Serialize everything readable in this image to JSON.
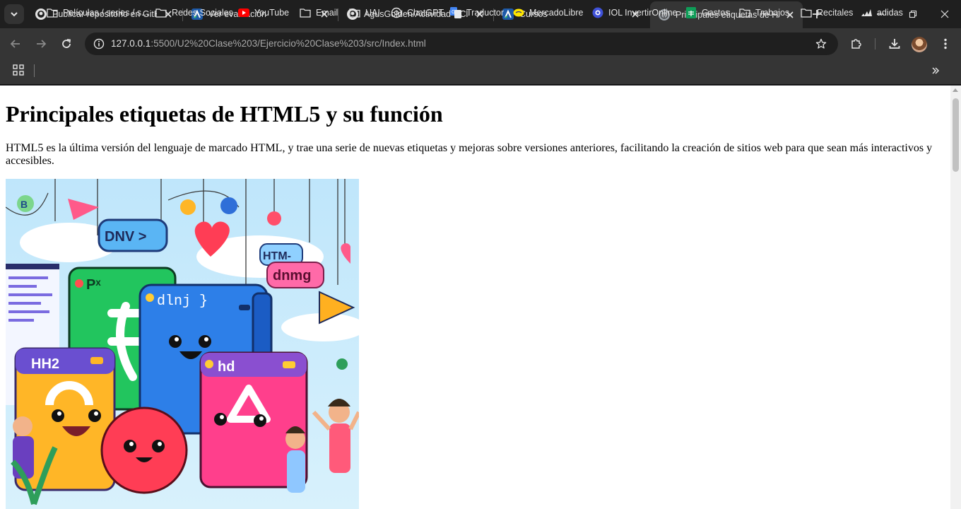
{
  "tabs": [
    {
      "title": "Publicar repositorio en GitHub",
      "icon": "github-icon",
      "active": false
    },
    {
      "title": "Ver evaluación",
      "icon": "campus-icon",
      "active": false
    },
    {
      "title": "AgusGolden/Actividad---Clase",
      "icon": "github-icon",
      "active": false
    },
    {
      "title": "Cursos",
      "icon": "campus-icon",
      "active": false
    },
    {
      "title": "Principales etiquetas de HTML5",
      "icon": "globe-icon",
      "active": true
    }
  ],
  "toolbar": {
    "url_host": "127.0.0.1",
    "url_rest": ":5500/U2%20Clase%203/Ejercicio%20Clase%203/src/Index.html"
  },
  "bookmarks": [
    {
      "label": "Películas / series / s...",
      "icon": "folder-icon"
    },
    {
      "label": "Redes Sociales",
      "icon": "folder-icon"
    },
    {
      "label": "YouTube",
      "icon": "youtube-icon"
    },
    {
      "label": "Email",
      "icon": "folder-icon"
    },
    {
      "label": "UAI",
      "icon": "folder-icon"
    },
    {
      "label": "ChatGPT",
      "icon": "chatgpt-icon"
    },
    {
      "label": "Traductor",
      "icon": "translate-icon"
    },
    {
      "label": "MercadoLibre",
      "icon": "mercadolibre-icon"
    },
    {
      "label": "IOL InvertirOnline",
      "icon": "iol-icon"
    },
    {
      "label": "Gastos",
      "icon": "sheets-icon"
    },
    {
      "label": "Trabajos",
      "icon": "folder-icon"
    },
    {
      "label": "Recitales",
      "icon": "folder-icon"
    },
    {
      "label": "adidas",
      "icon": "adidas-icon"
    }
  ],
  "page": {
    "heading": "Principales etiquetas de HTML5 y su función",
    "paragraph": "HTML5 es la última versión del lenguaje de marcado HTML, y trae una serie de nuevas etiquetas y mejoras sobre versiones anteriores, facilitando la creación de sitios web para que sean más interactivos y accesibles.",
    "image_labels": {
      "bubble_dnv": "DNV >",
      "bubble_htm": "HTM-",
      "bubble_dnmg": "dnmg",
      "card_green": "Pˣ",
      "card_blue": "dlnj }",
      "card_yellow": "HH2",
      "card_pink": "hd"
    }
  },
  "colors": {
    "tabstrip": "#1f1f1f",
    "toolbar": "#353535",
    "omnibox": "#1f1f1f",
    "page_bg": "#ffffff"
  }
}
